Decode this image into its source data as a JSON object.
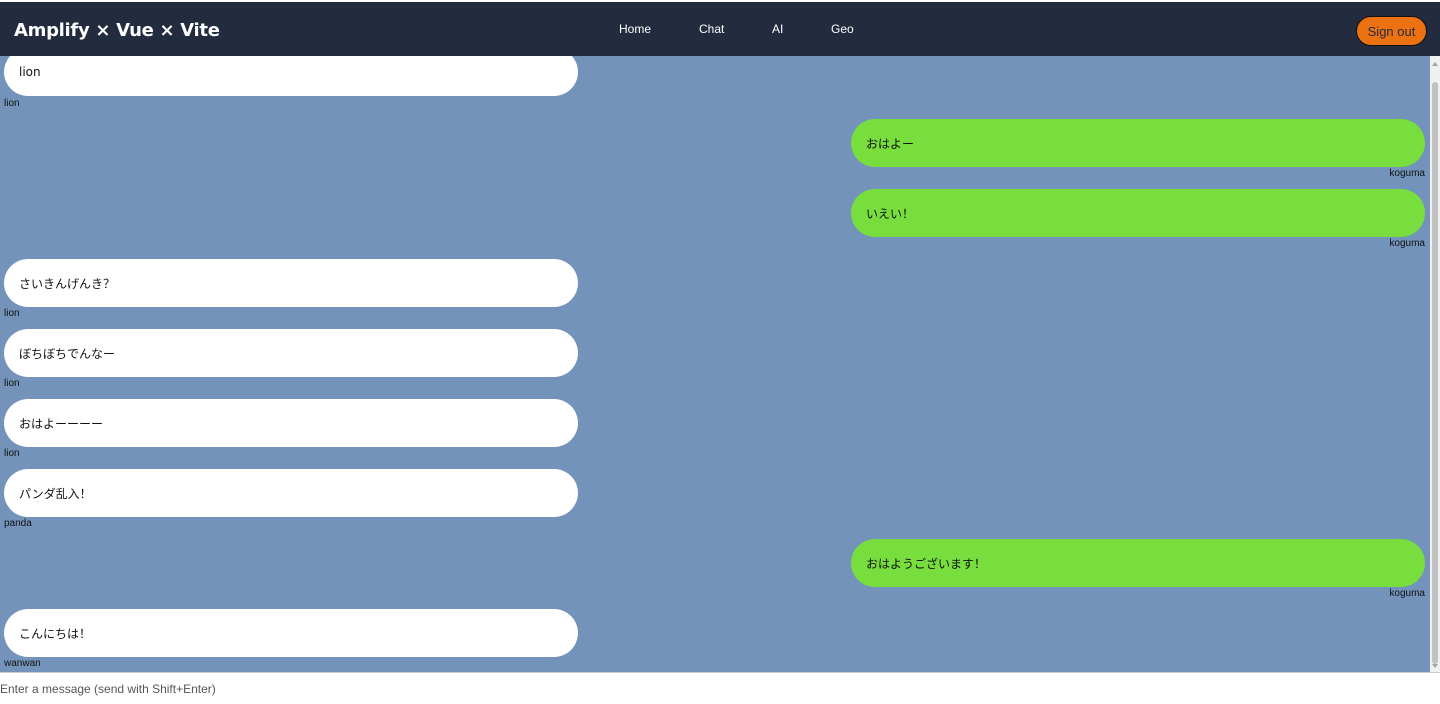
{
  "header": {
    "brand": "Amplify × Vue × Vite",
    "nav": [
      "Home",
      "Chat",
      "AI",
      "Geo"
    ],
    "signout_label": "Sign out"
  },
  "messages": [
    {
      "text": "lion",
      "sender": "lion",
      "side": "left"
    },
    {
      "text": "おはよー",
      "sender": "koguma",
      "side": "right"
    },
    {
      "text": "いえい！",
      "sender": "koguma",
      "side": "right"
    },
    {
      "text": "さいきんげんき？",
      "sender": "lion",
      "side": "left"
    },
    {
      "text": "ぼちぼちでんなー",
      "sender": "lion",
      "side": "left"
    },
    {
      "text": "おはよーーーー",
      "sender": "lion",
      "side": "left"
    },
    {
      "text": "パンダ乱入！",
      "sender": "panda",
      "side": "left"
    },
    {
      "text": "おはようございます！",
      "sender": "koguma",
      "side": "right"
    },
    {
      "text": "こんにちは！",
      "sender": "wanwan",
      "side": "left"
    }
  ],
  "composer": {
    "placeholder": "Enter a message (send with Shift+Enter)",
    "value": ""
  },
  "colors": {
    "navbar": "#232b3e",
    "chat_background": "#7393bb",
    "own_bubble": "#77de3d",
    "other_bubble": "#ffffff",
    "signout": "#ec7211"
  }
}
